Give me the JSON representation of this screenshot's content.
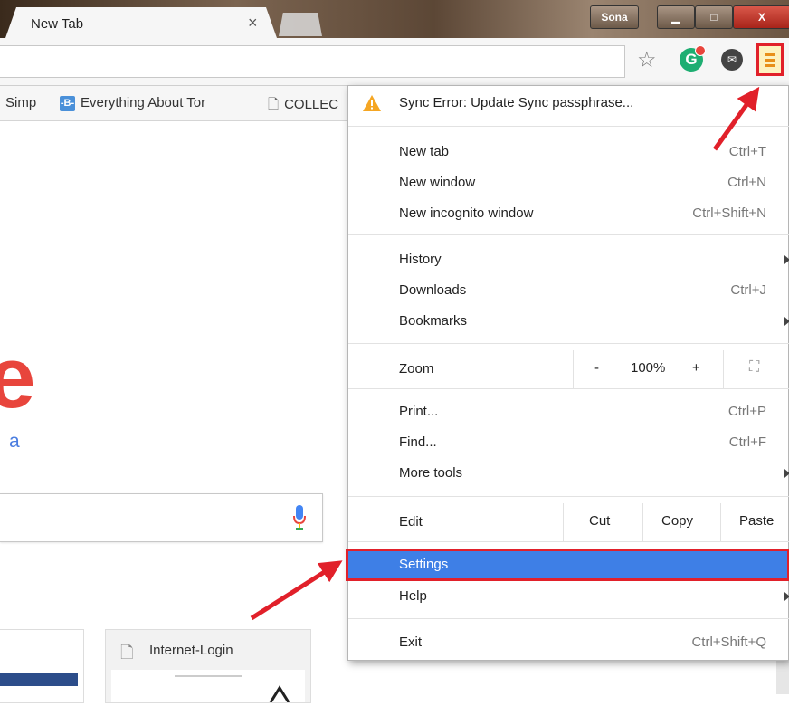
{
  "browser": {
    "tab_title": "New Tab",
    "tab_close": "×",
    "user_name": "Sona",
    "min_glyph": "▁",
    "max_glyph": "□",
    "close_glyph": "X"
  },
  "toolbar": {
    "icons": [
      "star-icon",
      "grammarly-icon",
      "extension-icon",
      "hamburger-menu-icon"
    ],
    "grammarly_glyph": "G",
    "star_glyph": "☆",
    "ext_glyph": "✉"
  },
  "bookmarks": {
    "items": [
      {
        "label": "Simp"
      },
      {
        "label": "Everything About Tor",
        "icon_text": "-B-"
      },
      {
        "label": "COLLEC"
      }
    ],
    "page_glyph": "🗋"
  },
  "page": {
    "logo_letter": "e",
    "logo_sub": "a",
    "tiles": [
      {
        "title": "Internet-Login"
      }
    ]
  },
  "menu": {
    "sync_error": "Sync Error: Update Sync passphrase...",
    "new_tab": {
      "label": "New tab",
      "shortcut": "Ctrl+T"
    },
    "new_window": {
      "label": "New window",
      "shortcut": "Ctrl+N"
    },
    "new_incognito": {
      "label": "New incognito window",
      "shortcut": "Ctrl+Shift+N"
    },
    "history": {
      "label": "History"
    },
    "downloads": {
      "label": "Downloads",
      "shortcut": "Ctrl+J"
    },
    "bookmarks": {
      "label": "Bookmarks"
    },
    "zoom": {
      "label": "Zoom",
      "minus": "-",
      "value": "100%",
      "plus": "+",
      "fullscreen": "⛶"
    },
    "print": {
      "label": "Print...",
      "shortcut": "Ctrl+P"
    },
    "find": {
      "label": "Find...",
      "shortcut": "Ctrl+F"
    },
    "more_tools": {
      "label": "More tools"
    },
    "edit": {
      "label": "Edit",
      "cut": "Cut",
      "copy": "Copy",
      "paste": "Paste"
    },
    "settings": {
      "label": "Settings"
    },
    "help": {
      "label": "Help"
    },
    "exit": {
      "label": "Exit",
      "shortcut": "Ctrl+Shift+Q"
    }
  },
  "colors": {
    "highlight": "#3e7fe6",
    "annotation_red": "#e1202a",
    "warning": "#f5a623"
  }
}
